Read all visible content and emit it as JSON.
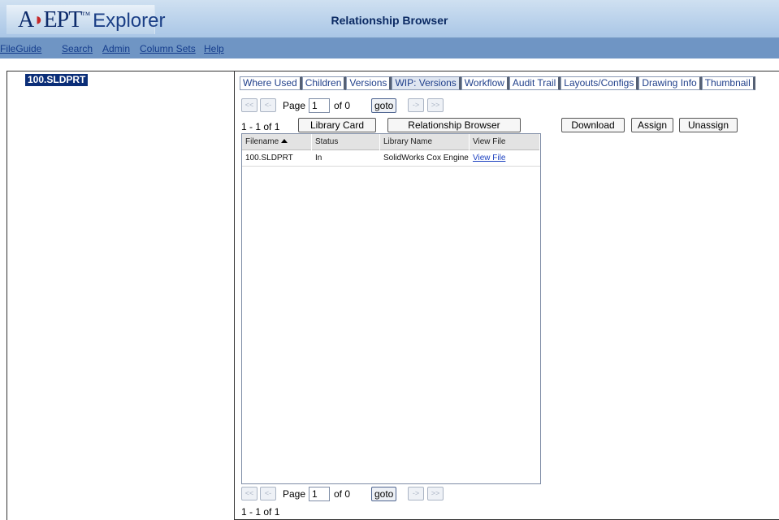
{
  "header": {
    "logo_main": "A",
    "logo_part2": "EPT",
    "logo_tm": "™",
    "logo_brand2": "Explorer",
    "window_title": "Relationship Browser"
  },
  "menu": {
    "items": [
      "FileGuide",
      "Search",
      "Admin",
      "Column Sets",
      "Help"
    ]
  },
  "tree": {
    "selected_node": "100.SLDPRT"
  },
  "tabs": [
    "Where Used",
    "Children",
    "Versions",
    "WIP: Versions",
    "Workflow",
    "Audit Trail",
    "Layouts/Configs",
    "Drawing Info",
    "Thumbnail"
  ],
  "active_tab": "WIP: Versions",
  "pager": {
    "first": "<<",
    "prev": "<-",
    "page_label": "Page",
    "page_value": "1",
    "of_label": "of 0",
    "goto_label": "goto",
    "next": "->",
    "last": ">>"
  },
  "count_text": "1 - 1 of 1",
  "actions": {
    "library_card": "Library Card",
    "relationship_browser": "Relationship Browser",
    "download": "Download",
    "assign": "Assign",
    "unassign": "Unassign"
  },
  "grid": {
    "columns": [
      "Filename",
      "Status",
      "Library Name",
      "View File"
    ],
    "sort_column": "Filename",
    "sort_direction": "ascending",
    "rows": [
      {
        "filename": "100.SLDPRT",
        "status": "In",
        "library": "SolidWorks Cox Engine",
        "view": "View File"
      }
    ]
  },
  "colors": {
    "menubar": "#6f95c4",
    "selected_node": "#0b2e78",
    "link": "#1a3fbf"
  }
}
